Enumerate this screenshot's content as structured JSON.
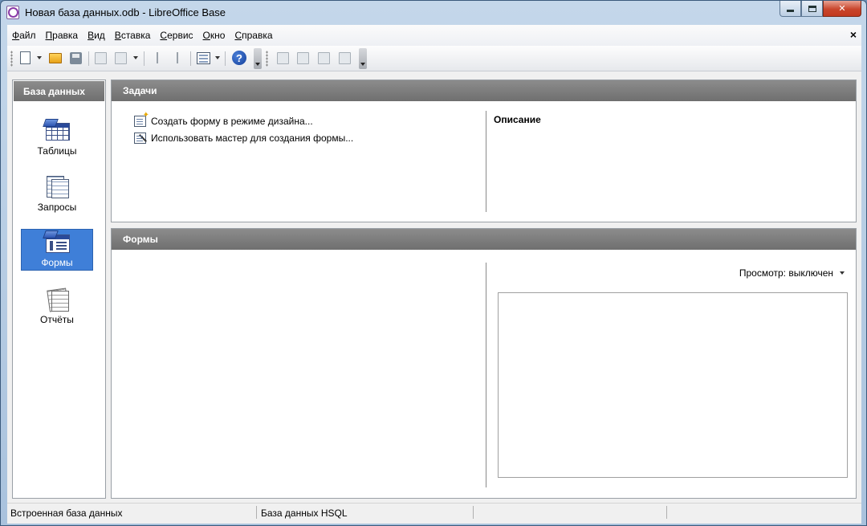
{
  "window": {
    "title": "Новая база данных.odb - LibreOffice Base"
  },
  "menubar": {
    "items": [
      "Файл",
      "Правка",
      "Вид",
      "Вставка",
      "Сервис",
      "Окно",
      "Справка"
    ],
    "close_glyph": "×"
  },
  "toolbar": {
    "help_glyph": "?"
  },
  "left_panel": {
    "header": "База данных",
    "items": [
      {
        "label": "Таблицы",
        "icon": "table-icon",
        "selected": false
      },
      {
        "label": "Запросы",
        "icon": "query-icon",
        "selected": false
      },
      {
        "label": "Формы",
        "icon": "form-icon",
        "selected": true
      },
      {
        "label": "Отчёты",
        "icon": "report-icon",
        "selected": false
      }
    ]
  },
  "tasks": {
    "header": "Задачи",
    "items": [
      {
        "label": "Создать форму в режиме дизайна...",
        "icon": "form-design-icon"
      },
      {
        "label": "Использовать мастер для создания формы...",
        "icon": "form-wizard-icon"
      }
    ],
    "description_label": "Описание"
  },
  "forms": {
    "header": "Формы",
    "preview_label": "Просмотр: выключен"
  },
  "statusbar": {
    "cells": [
      "Встроенная база данных",
      "База данных HSQL",
      "",
      ""
    ]
  },
  "colors": {
    "header_gray": "#7a7a7a",
    "selection_blue": "#3f7fd8",
    "close_red": "#c9462c"
  }
}
